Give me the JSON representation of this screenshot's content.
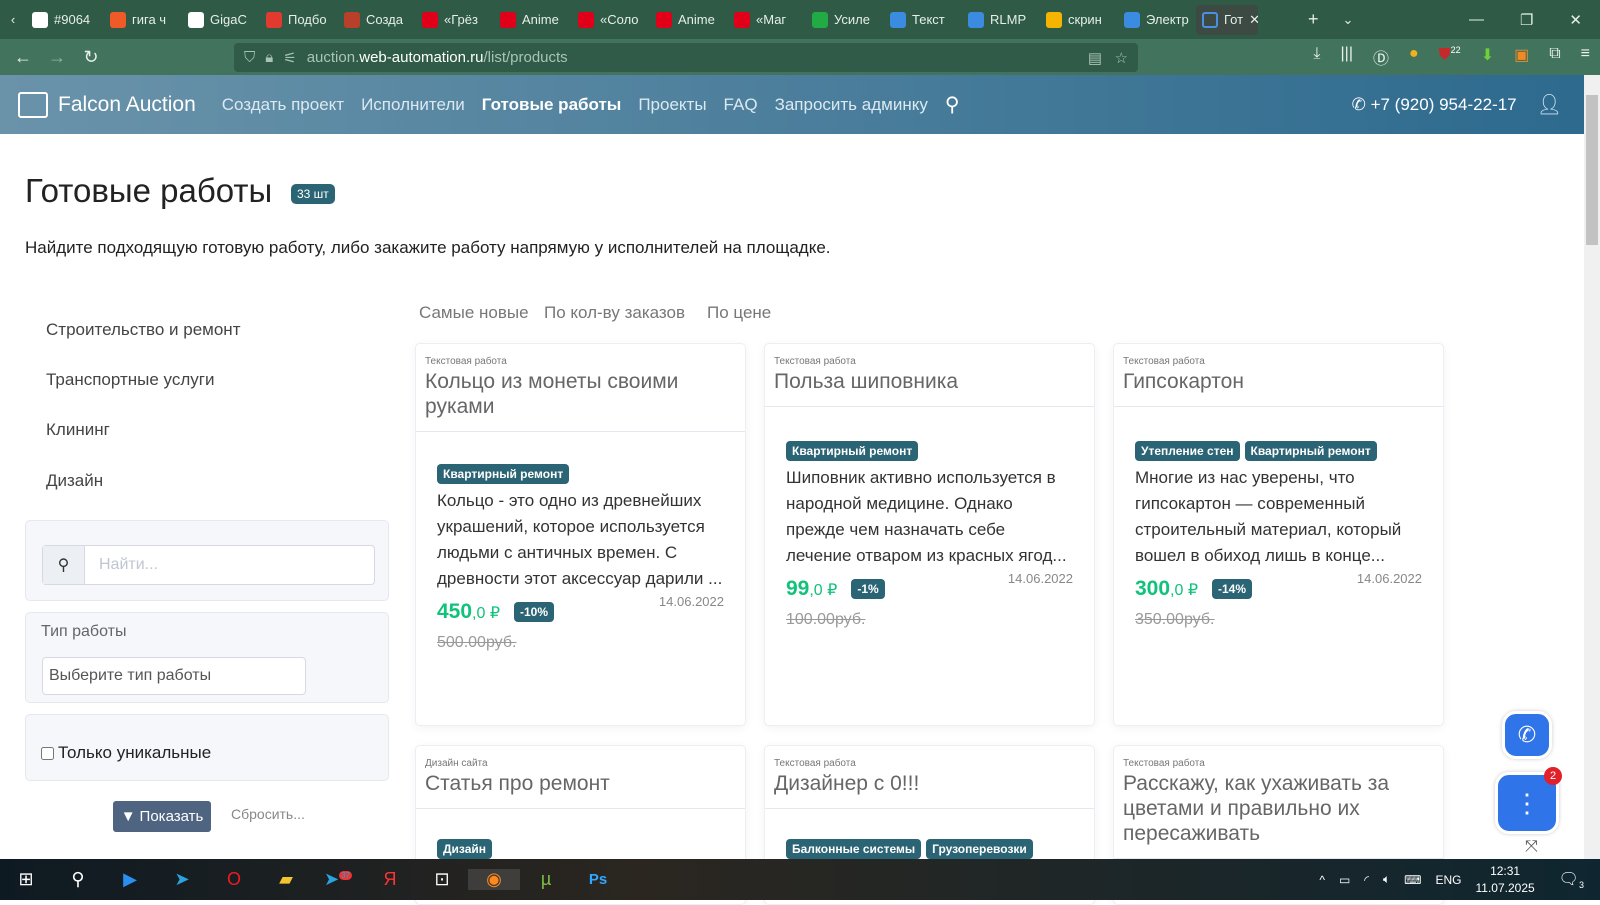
{
  "browser": {
    "tabs": [
      {
        "label": "#9064",
        "color": "#ffffff"
      },
      {
        "label": "гига ч",
        "color": "#f05a28"
      },
      {
        "label": "GigaC",
        "color": "#ffffff"
      },
      {
        "label": "Подбо",
        "color": "#e23a2e"
      },
      {
        "label": "Созда",
        "color": "#b8402a"
      },
      {
        "label": "«Грёз",
        "color": "#e0001a"
      },
      {
        "label": "Anime",
        "color": "#e0001a"
      },
      {
        "label": "«Соло",
        "color": "#e0001a"
      },
      {
        "label": "Anime",
        "color": "#e0001a"
      },
      {
        "label": "«Маг",
        "color": "#e0001a"
      },
      {
        "label": "Усиле",
        "color": "#22aa44"
      },
      {
        "label": "Текст",
        "color": "#3b8be0"
      },
      {
        "label": "RLMP",
        "color": "#3b8be0"
      },
      {
        "label": "скрин",
        "color": "#f4b400"
      },
      {
        "label": "Электр",
        "color": "#3b8be0"
      }
    ],
    "active_tab": "Гот",
    "url_prefix": "auction.",
    "url_domain": "web-automation.ru",
    "url_path": "/list/products",
    "ext_badge": "22"
  },
  "header": {
    "brand": "Falcon Auction",
    "nav": [
      "Создать проект",
      "Исполнители",
      "Готовые работы",
      "Проекты",
      "FAQ",
      "Запросить админку"
    ],
    "phone": "+7 (920) 954-22-17"
  },
  "page": {
    "title": "Готовые работы",
    "count": "33 шт",
    "subtitle": "Найдите подходящую готовую работу, либо закажите работу напрямую у исполнителей на площадке."
  },
  "sidebar": {
    "categories": [
      "Строительство и ремонт",
      "Транспортные услуги",
      "Клининг",
      "Дизайн"
    ],
    "search_placeholder": "Найти...",
    "type_label": "Тип работы",
    "type_placeholder": "Выберите тип работы",
    "unique_label": "Только уникальные",
    "show_btn": "Показать",
    "reset": "Сбросить..."
  },
  "sort": [
    "Самые новые",
    "По кол-ву заказов",
    "По цене"
  ],
  "cards": [
    {
      "type": "Текстовая работа",
      "title": "Кольцо из монеты своими руками",
      "tags": [
        "Квартирный ремонт"
      ],
      "desc": "Кольцо - это одно из древнейших украшений, которое используется людьми с античных времен. С древности этот аксессуар дарили ...",
      "price": "450",
      "price_frac": ",0 ₽",
      "discount": "-10%",
      "date": "14.06.2022",
      "old": "500.00руб."
    },
    {
      "type": "Текстовая работа",
      "title": "Польза шиповника",
      "tags": [
        "Квартирный ремонт"
      ],
      "desc": "Шиповник активно используется в народной медицине. Однако прежде чем назначать себе лечение отваром из красных ягод...",
      "price": "99",
      "price_frac": ",0 ₽",
      "discount": "-1%",
      "date": "14.06.2022",
      "old": "100.00руб."
    },
    {
      "type": "Текстовая работа",
      "title": "Гипсокартон",
      "tags": [
        "Утепление стен",
        "Квартирный ремонт"
      ],
      "desc": "Многие из нас уверены, что гипсокартон — современный строительный материал, который вошел в обиход лишь в конце...",
      "price": "300",
      "price_frac": ",0 ₽",
      "discount": "-14%",
      "date": "14.06.2022",
      "old": "350.00руб."
    },
    {
      "type": "Дизайн сайта",
      "title": "Статья про ремонт",
      "tags": [
        "Дизайн"
      ]
    },
    {
      "type": "Текстовая работа",
      "title": "Дизайнер с 0!!!",
      "tags": [
        "Балконные системы",
        "Грузоперевозки"
      ]
    },
    {
      "type": "Текстовая работа",
      "title": "Расскажу, как ухаживать за цветами и правильно их пересаживать",
      "tags": []
    }
  ],
  "chat": {
    "badge": "2"
  },
  "taskbar": {
    "telegram_badge": "37",
    "lang": "ENG",
    "time": "12:31",
    "date": "11.07.2025",
    "notif": "3"
  }
}
